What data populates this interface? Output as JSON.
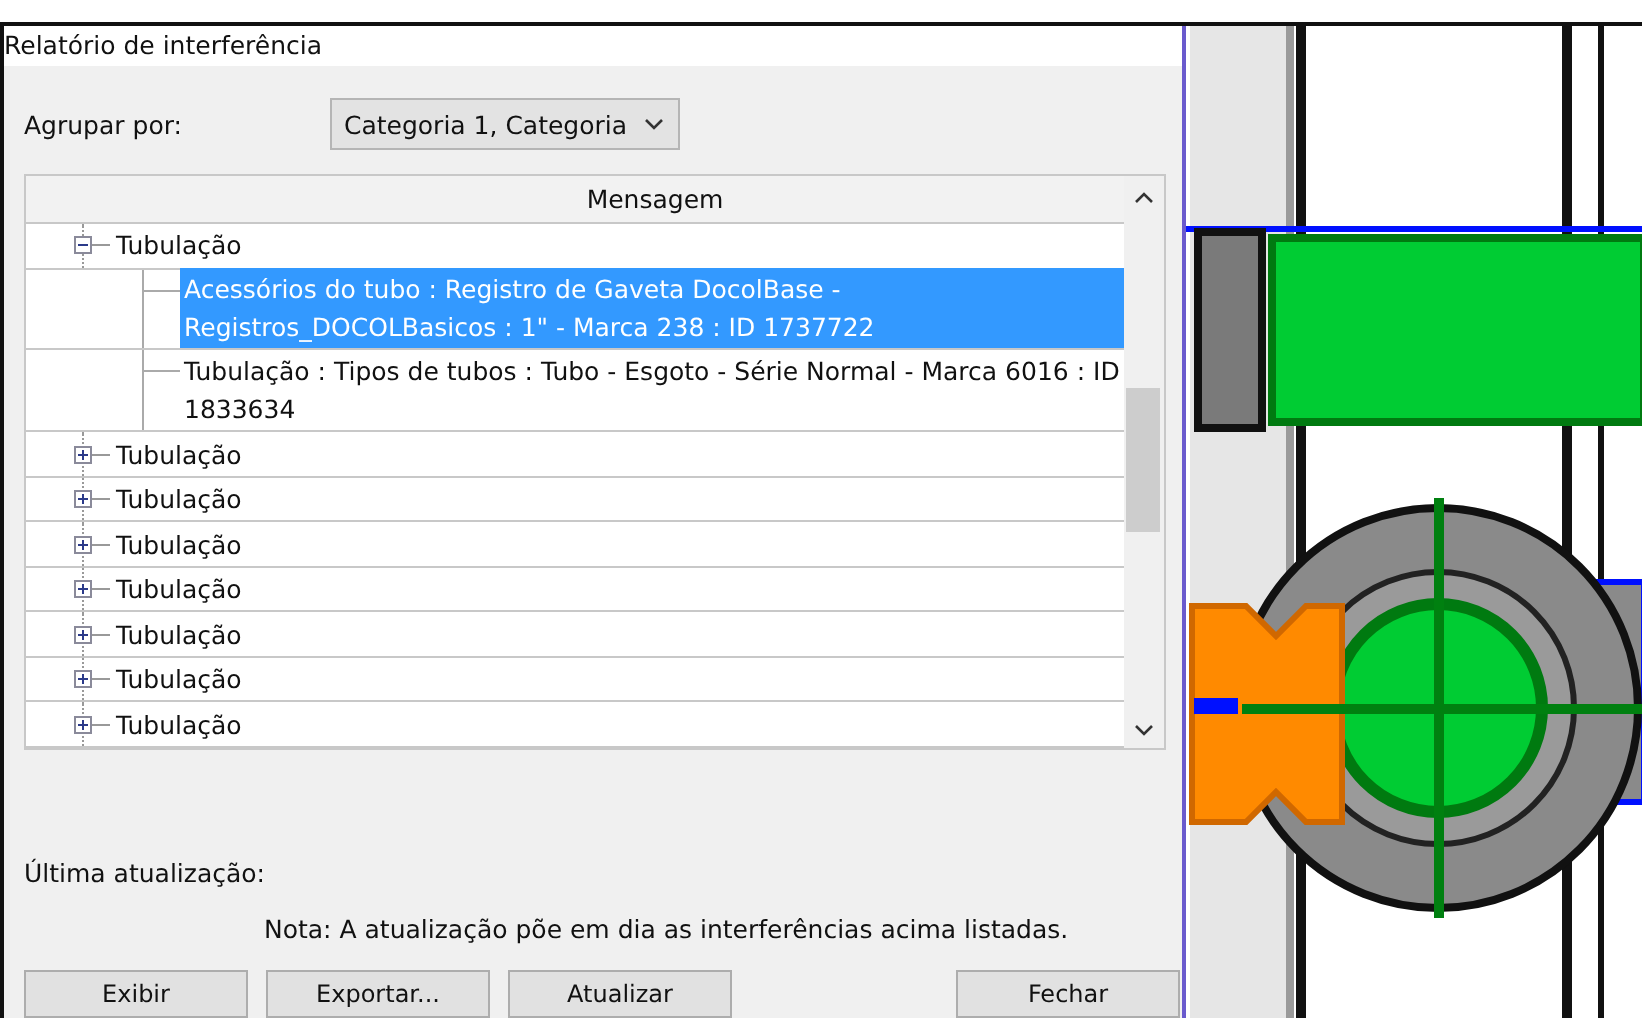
{
  "window": {
    "title": "Relatório de interferência"
  },
  "group_by": {
    "label": "Agrupar por:",
    "value": "Categoria 1, Categoria"
  },
  "tree": {
    "column": "Mensagem",
    "items": [
      {
        "label": "Tubulação",
        "expanded": true,
        "children": [
          {
            "label": "Acessórios do tubo : Registro de Gaveta DocolBase - Registros_DOCOLBasicos : 1\" - Marca 238 : ID 1737722",
            "selected": true
          },
          {
            "label": "Tubulação : Tipos de tubos : Tubo - Esgoto - Série Normal - Marca 6016 : ID 1833634",
            "selected": false
          }
        ]
      },
      {
        "label": "Tubulação",
        "expanded": false
      },
      {
        "label": "Tubulação",
        "expanded": false
      },
      {
        "label": "Tubulação",
        "expanded": false
      },
      {
        "label": "Tubulação",
        "expanded": false
      },
      {
        "label": "Tubulação",
        "expanded": false
      },
      {
        "label": "Tubulação",
        "expanded": false
      },
      {
        "label": "Tubulação",
        "expanded": false
      }
    ]
  },
  "last_update": {
    "label": "Última atualização:"
  },
  "note": "Nota: A atualização põe em dia as interferências acima listadas.",
  "buttons": [
    "Exibir",
    "Exportar...",
    "Atualizar",
    "Fechar"
  ]
}
